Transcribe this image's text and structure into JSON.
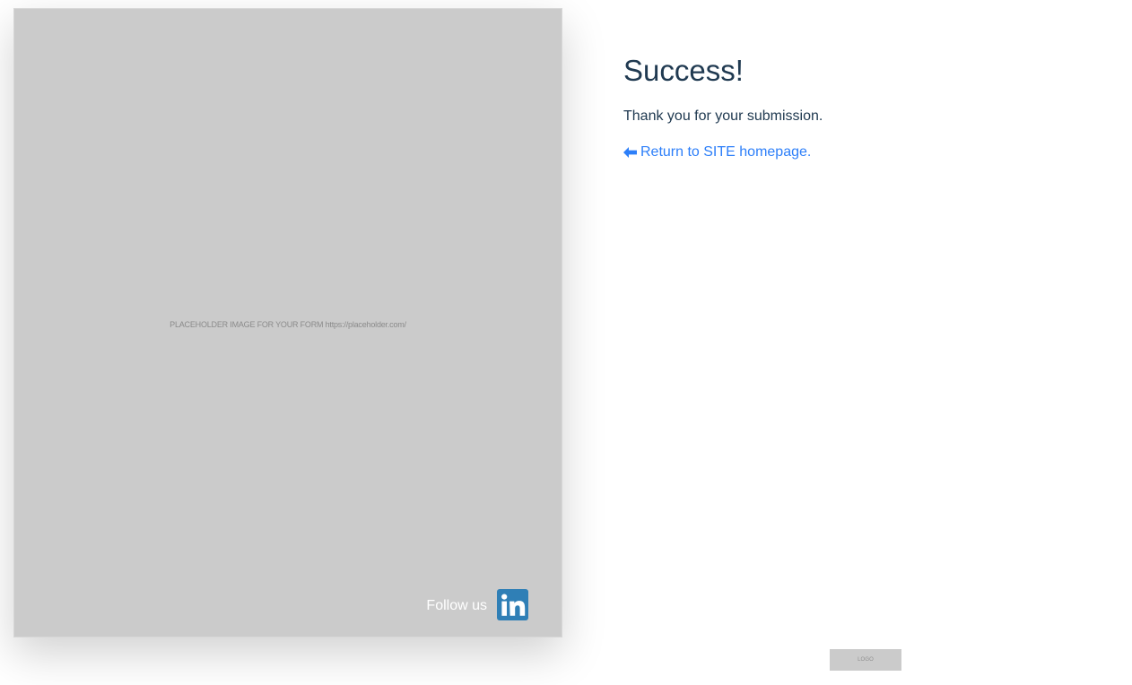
{
  "hero": {
    "placeholder_text": "PLACEHOLDER IMAGE FOR YOUR FORM https://placeholder.com/",
    "follow_label": "Follow us",
    "social_icon": "linkedin-icon",
    "colors": {
      "panel": "#cbcbcb",
      "linkedin": "#2f7fb6"
    }
  },
  "success": {
    "title": "Success!",
    "message": "Thank you for your submission.",
    "return_link": "Return to SITE homepage.",
    "return_icon": "arrow-left-icon",
    "colors": {
      "heading": "#203a51",
      "link": "#2d7ff9"
    }
  },
  "footer": {
    "logo_text": "LOGO"
  }
}
